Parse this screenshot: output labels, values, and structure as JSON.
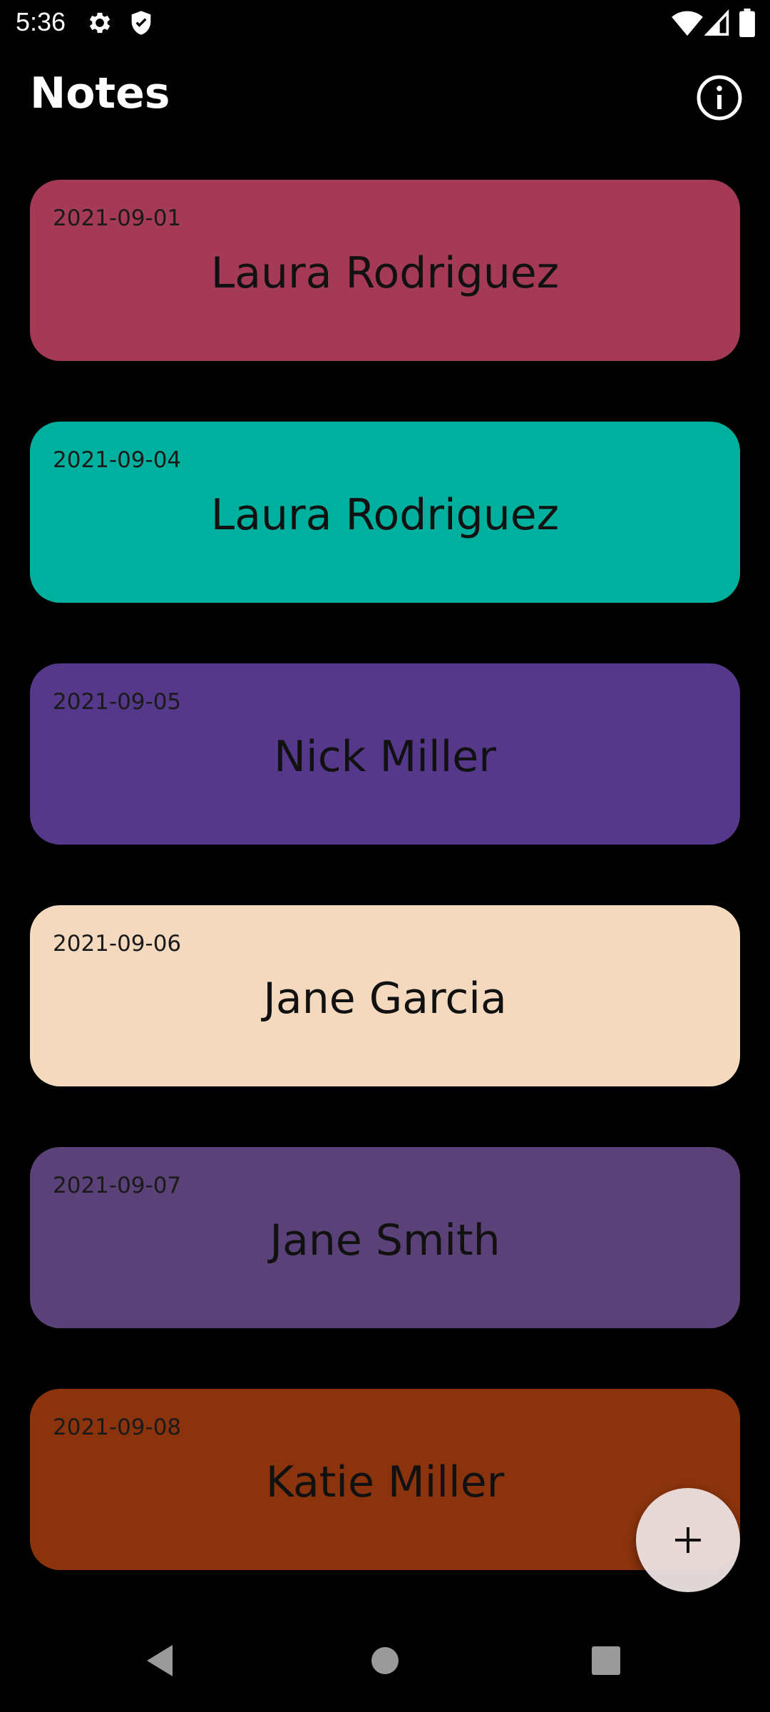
{
  "status_bar": {
    "time": "5:36",
    "icons": [
      "gear-icon",
      "shield-icon",
      "wifi-icon",
      "signal-icon",
      "battery-icon"
    ]
  },
  "app_bar": {
    "title": "Notes",
    "info_icon": "info-icon"
  },
  "notes": [
    {
      "date": "2021-09-01",
      "name": "Laura Rodriguez",
      "color": "#A53A56"
    },
    {
      "date": "2021-09-04",
      "name": "Laura Rodriguez",
      "color": "#00B09E"
    },
    {
      "date": "2021-09-05",
      "name": "Nick Miller",
      "color": "#553889"
    },
    {
      "date": "2021-09-06",
      "name": "Jane Garcia",
      "color": "#F5D9BF"
    },
    {
      "date": "2021-09-07",
      "name": "Jane Smith",
      "color": "#5A4177"
    },
    {
      "date": "2021-09-08",
      "name": "Katie Miller",
      "color": "#8B330D"
    }
  ],
  "fab": {
    "icon": "plus-icon"
  },
  "nav_bar": {
    "icons": [
      "back-icon",
      "home-icon",
      "recents-icon"
    ]
  }
}
